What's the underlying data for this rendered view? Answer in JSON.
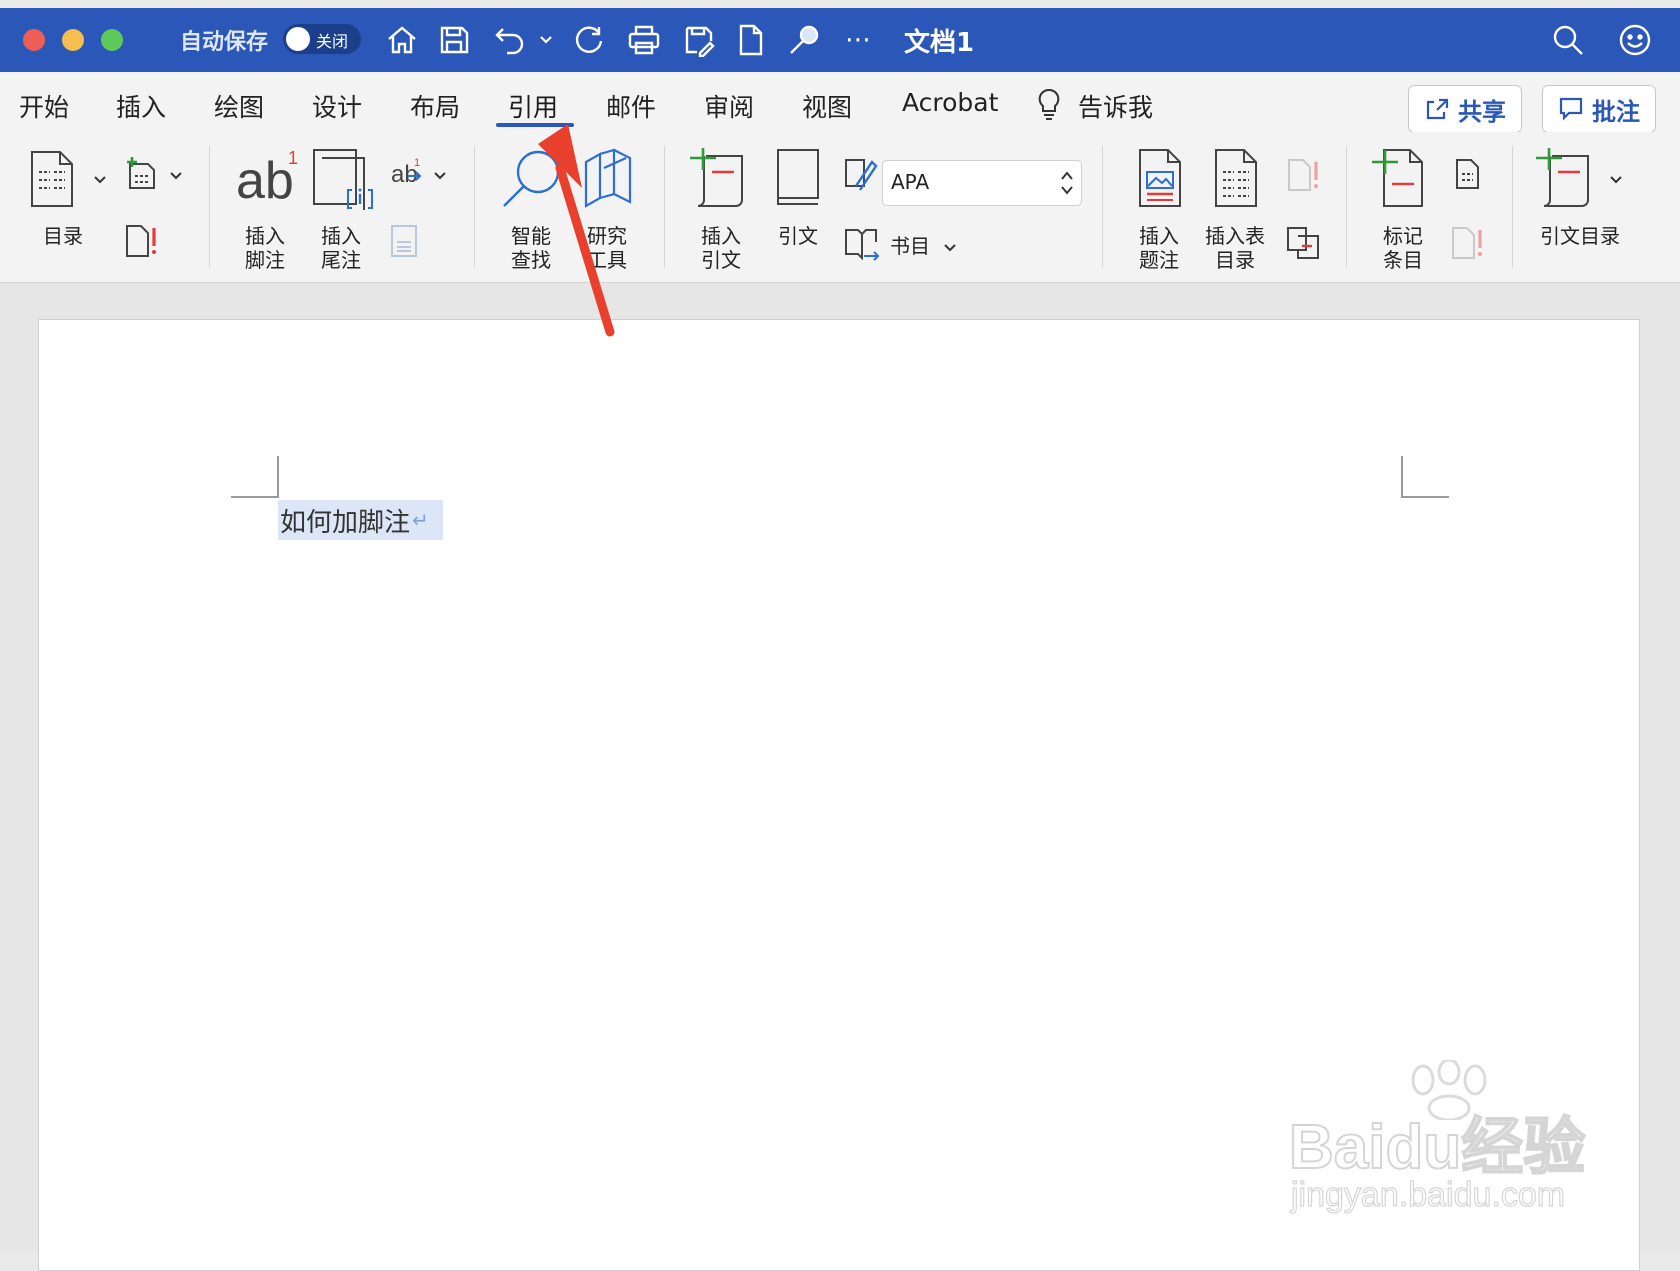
{
  "window": {
    "title": "文档1",
    "autosave_label": "自动保存",
    "autosave_state": "关闭"
  },
  "tabs": [
    "开始",
    "插入",
    "绘图",
    "设计",
    "布局",
    "引用",
    "邮件",
    "审阅",
    "视图",
    "Acrobat",
    "告诉我"
  ],
  "active_tab": "引用",
  "share_button": "共享",
  "comment_button": "批注",
  "ribbon": {
    "toc": "目录",
    "insert_footnote": [
      "插入",
      "脚注"
    ],
    "insert_endnote": [
      "插入",
      "尾注"
    ],
    "smart_lookup": [
      "智能",
      "查找"
    ],
    "researcher": [
      "研究",
      "工具"
    ],
    "insert_citation": [
      "插入",
      "引文"
    ],
    "citation": "引文",
    "style_value": "APA",
    "bibliography": "书目",
    "insert_caption": [
      "插入",
      "题注"
    ],
    "insert_table_of_figures": [
      "插入表",
      "目录"
    ],
    "mark_entry": [
      "标记",
      "条目"
    ],
    "table_of_authorities": "引文目录"
  },
  "document": {
    "text": "如何加脚注",
    "paragraph_mark": "↵"
  },
  "watermark": {
    "brand": "Baidu经验",
    "url": "jingyan.baidu.com"
  },
  "colors": {
    "titlebar": "#2b57b8",
    "accent": "#2b57b8",
    "arrow": "#e8402c",
    "selection": "#dce6f7"
  }
}
